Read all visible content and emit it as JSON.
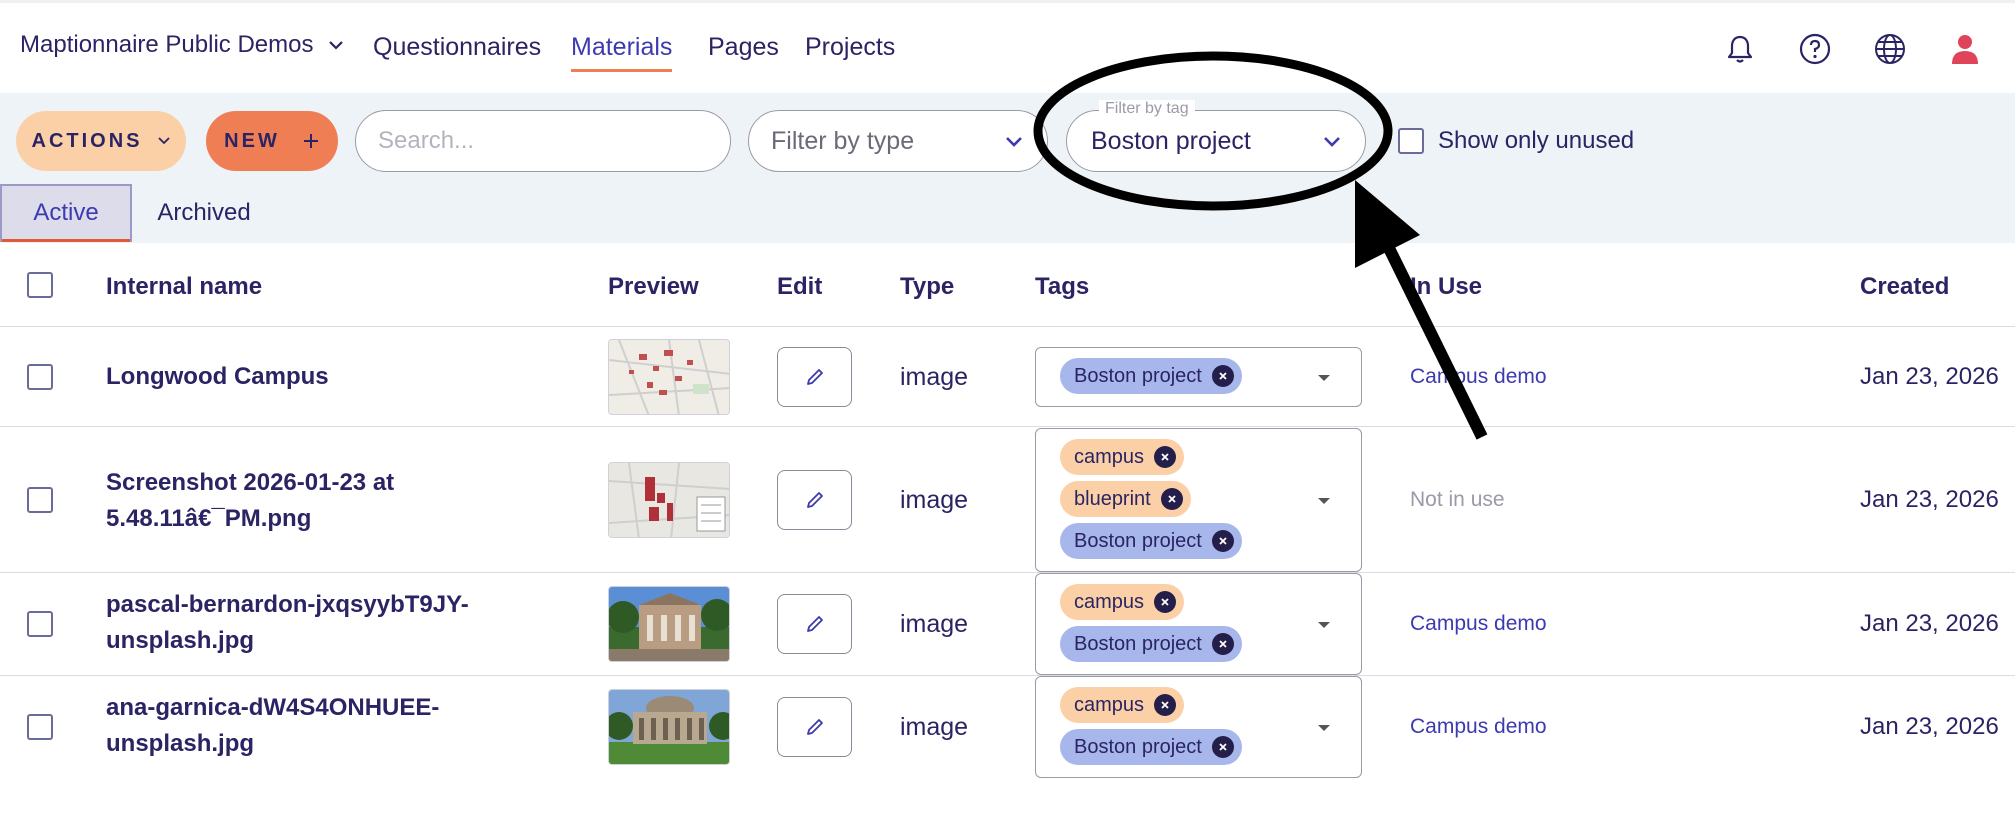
{
  "header": {
    "org_name": "Maptionnaire Public Demos",
    "nav": [
      {
        "label": "Questionnaires"
      },
      {
        "label": "Materials"
      },
      {
        "label": "Pages"
      },
      {
        "label": "Projects"
      }
    ],
    "active_nav": "Materials",
    "icons": [
      "bell-icon",
      "help-circle-icon",
      "globe-icon",
      "user-icon"
    ]
  },
  "toolbar": {
    "actions_label": "ACTIONS",
    "new_label": "NEW",
    "search_placeholder": "Search...",
    "filter_type_placeholder": "Filter by type",
    "filter_tag_label": "Filter by tag",
    "filter_tag_value": "Boston project",
    "show_unused_label": "Show only unused",
    "show_unused_checked": false
  },
  "tabs": [
    {
      "label": "Active",
      "active": true
    },
    {
      "label": "Archived",
      "active": false
    }
  ],
  "table": {
    "columns": [
      "Internal name",
      "Preview",
      "Edit",
      "Type",
      "Tags",
      "In Use",
      "Created"
    ],
    "rows": [
      {
        "name": "Longwood Campus",
        "type": "image",
        "tags": [
          "Boston project"
        ],
        "in_use": "Campus demo",
        "created": "Jan 23, 2026"
      },
      {
        "name": "Screenshot 2026-01-23 at 5.48.11â€¯PM.png",
        "type": "image",
        "tags": [
          "campus",
          "blueprint",
          "Boston project"
        ],
        "in_use": "Not in use",
        "created": "Jan 23, 2026"
      },
      {
        "name": "pascal-bernardon-jxqsyybT9JY-unsplash.jpg",
        "type": "image",
        "tags": [
          "campus",
          "Boston project"
        ],
        "in_use": "Campus demo",
        "created": "Jan 23, 2026"
      },
      {
        "name": "ana-garnica-dW4S4ONHUEE-unsplash.jpg",
        "type": "image",
        "tags": [
          "campus",
          "Boston project"
        ],
        "in_use": "Campus demo",
        "created": "Jan 23, 2026"
      }
    ]
  },
  "colors": {
    "primary_text": "#2b2464",
    "accent_orange": "#ef7e55",
    "chip_blue": "#a7b7ec",
    "chip_orange": "#fbd0a6",
    "toolbar_bg": "#eef3f8"
  }
}
